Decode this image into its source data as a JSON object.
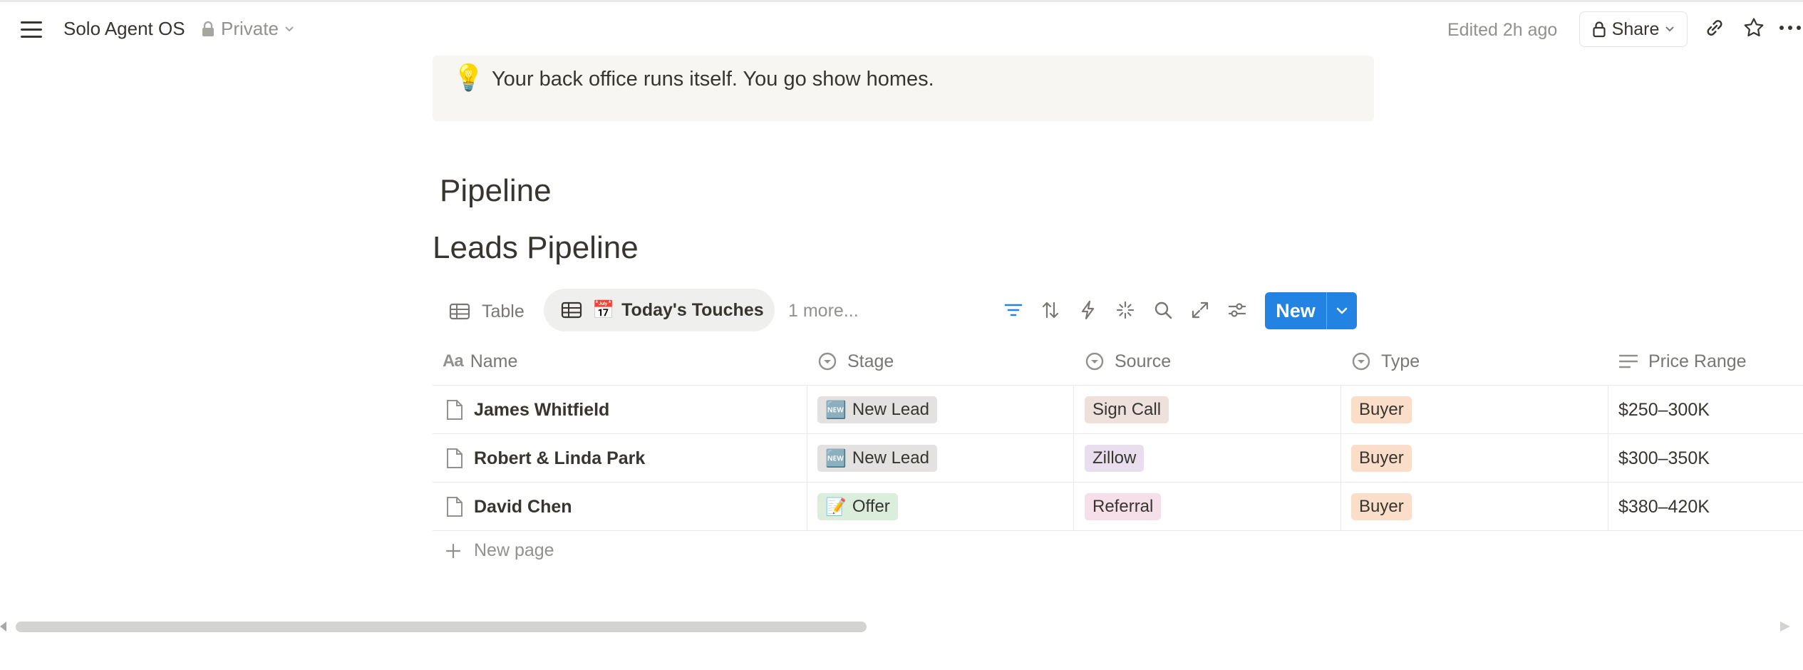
{
  "topbar": {
    "workspace_title": "Solo Agent OS",
    "privacy_label": "Private",
    "edited_text": "Edited 2h ago",
    "share_label": "Share"
  },
  "callout": {
    "icon": "💡",
    "text": "Your back office runs itself. You go show homes."
  },
  "headings": {
    "section": "Pipeline",
    "database": "Leads Pipeline"
  },
  "views": {
    "table_label": "Table",
    "active_emoji": "📅",
    "active_label": "Today's Touches",
    "more_label": "1 more..."
  },
  "toolbar": {
    "new_label": "New",
    "accent_color": "#2383e2"
  },
  "table": {
    "columns": [
      {
        "label": "Name",
        "icon": "text-type-icon"
      },
      {
        "label": "Stage",
        "icon": "select-icon"
      },
      {
        "label": "Source",
        "icon": "select-icon"
      },
      {
        "label": "Type",
        "icon": "select-icon"
      },
      {
        "label": "Price Range",
        "icon": "text-lines-icon"
      }
    ],
    "rows": [
      {
        "name": "James Whitfield",
        "stage": {
          "emoji": "🆕",
          "label": "New Lead",
          "color": "#e3e2e0"
        },
        "source": {
          "label": "Sign Call",
          "color": "#eee0da"
        },
        "type": {
          "label": "Buyer",
          "color": "#fadec9"
        },
        "price": "$250–300K"
      },
      {
        "name": "Robert & Linda Park",
        "stage": {
          "emoji": "🆕",
          "label": "New Lead",
          "color": "#e3e2e0"
        },
        "source": {
          "label": "Zillow",
          "color": "#e8deee"
        },
        "type": {
          "label": "Buyer",
          "color": "#fadec9"
        },
        "price": "$300–350K"
      },
      {
        "name": "David Chen",
        "stage": {
          "emoji": "📝",
          "label": "Offer",
          "color": "#dbeddb"
        },
        "source": {
          "label": "Referral",
          "color": "#f5e0e9"
        },
        "type": {
          "label": "Buyer",
          "color": "#fadec9"
        },
        "price": "$380–420K"
      }
    ],
    "new_page_label": "New page"
  }
}
